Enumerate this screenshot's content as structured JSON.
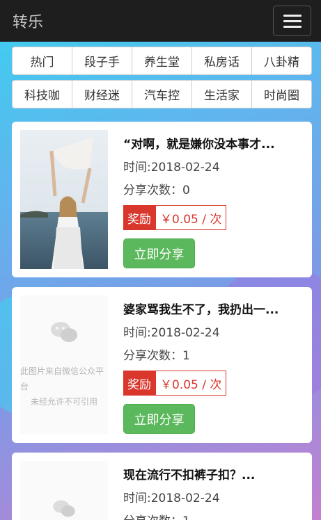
{
  "brand": "转乐",
  "categories_row1": [
    "热门",
    "段子手",
    "养生堂",
    "私房话",
    "八卦精"
  ],
  "categories_row2": [
    "科技咖",
    "财经迷",
    "汽车控",
    "生活家",
    "时尚圈"
  ],
  "articles": [
    {
      "title": "“对啊，就是嫌你没本事才...",
      "date": "时间:2018-02-24",
      "shares": "分享次数：0",
      "reward_label": "奖励",
      "reward_amount": "￥0.05 / 次",
      "share_label": "立即分享"
    },
    {
      "title": "婆家骂我生不了，我扔出一...",
      "date": "时间:2018-02-24",
      "shares": "分享次数：1",
      "reward_label": "奖励",
      "reward_amount": "￥0.05 / 次",
      "share_label": "立即分享",
      "placeholder_line1": "此图片来自微信公众平台",
      "placeholder_line2": "未经允许不可引用"
    },
    {
      "title": "现在流行不扣裤子扣？...",
      "date": "时间:2018-02-24",
      "shares": "分享次数：1"
    }
  ],
  "colors": {
    "navbar": "#1e1e1e",
    "reward": "#d9362c",
    "share_button": "#5cb85c"
  },
  "icons": [
    "menu-icon",
    "wechat-icon"
  ]
}
